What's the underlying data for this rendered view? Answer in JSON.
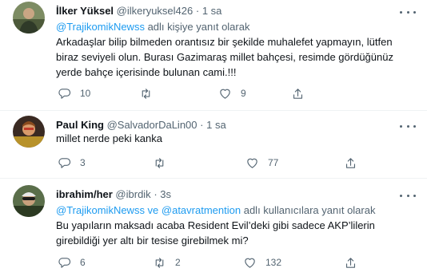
{
  "tweets": [
    {
      "name": "İlker Yüksel",
      "handle": "@ilkeryuksel426",
      "sep": "·",
      "time": "1 sa",
      "replying_mention": "@TrajikomikNewss",
      "replying_suffix": "adlı kişiye yanıt olarak",
      "text": "Arkadaşlar bilip bilmeden orantısız bir şekilde muhalefet yapmayın, lütfen biraz seviyeli olun. Burası Gazimaraş millet bahçesi, resimde gördüğünüz yerde bahçe içerisinde bulunan cami.!!!",
      "replies": "10",
      "retweets": "",
      "likes": "9"
    },
    {
      "name": "Paul King",
      "handle": "@SalvadorDaLin00",
      "sep": "·",
      "time": "1 sa",
      "text": "millet nerde peki kanka",
      "replies": "3",
      "retweets": "",
      "likes": "77"
    },
    {
      "name": "ibrahim/her",
      "handle": "@ibrdik",
      "sep": "·",
      "time": "3s",
      "replying_mention": "@TrajikomikNewss ve @atavratmention",
      "replying_suffix": "adlı kullanıcılara yanıt olarak",
      "text": "Bu yapıların maksadı acaba Resident Evil’deki gibi sadece AKP’lilerin girebildiği yer altı bir tesise girebilmek mi?",
      "replies": "6",
      "retweets": "2",
      "likes": "132"
    }
  ],
  "icons": [
    "reply-icon",
    "retweet-icon",
    "like-icon",
    "share-icon",
    "more-icon"
  ],
  "colors": {
    "text": "#0f1419",
    "secondary": "#536471",
    "accent": "#1d9bf0",
    "divider": "#eff3f4"
  }
}
